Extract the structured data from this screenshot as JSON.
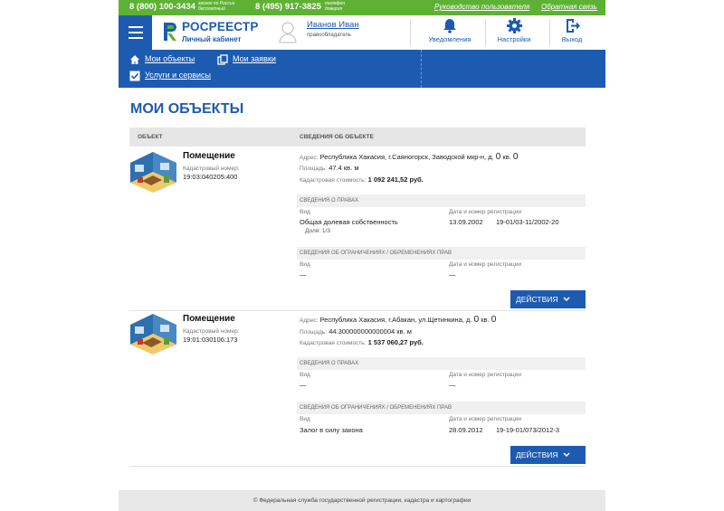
{
  "topbar": {
    "phone1": "8 (800) 100-3434",
    "phone1_note": "звонок по России бесплатный",
    "phone2": "8 (495) 917-3825",
    "phone2_note": "телефон доверия",
    "guide_link": "Руководство пользователя",
    "feedback_link": "Обратная связь"
  },
  "header": {
    "logo_title": "РОСРЕЕСТР",
    "logo_subtitle": "Личный кабинет",
    "user_name": "Иванов Иван",
    "user_role": "правообладатель",
    "notifications_label": "Уведомления",
    "settings_label": "Настройки",
    "logout_label": "Выход"
  },
  "nav": {
    "objects": "Мои объекты",
    "requests": "Мои заявки",
    "services": "Услуги и сервисы"
  },
  "page_title": "МОИ ОБЪЕКТЫ",
  "table": {
    "col_object": "ОБЪЕКТ",
    "col_info": "СВЕДЕНИЯ ОБ ОБЪЕКТЕ"
  },
  "labels": {
    "cadastral_number": "Кадастровый номер:",
    "address": "Адрес:",
    "area": "Площадь:",
    "cadastral_value": "Кадастровая стоимость:",
    "rights_section": "СВЕДЕНИЯ О ПРАВАХ",
    "restrictions_section": "СВЕДЕНИЯ ОБ ОГРАНИЧЕНИЯХ / ОБРЕМЕНЕНИЯХ ПРАВ",
    "kind": "Вид",
    "reg_date_number": "Дата и номер регистрации",
    "actions": "ДЕЙСТВИЯ"
  },
  "objects": [
    {
      "name": "Помещение",
      "cadastral": "19:03:040205:400",
      "address": "Республика Хакасия, г.Саяногорск, Заводской мкр-н, д.",
      "house": "0",
      "flat_prefix": "кв.",
      "flat": "0",
      "area": "47.4 кв. м",
      "value": "1 092 241,52 руб.",
      "rights_kind": "Общая долевая собственность",
      "rights_share": "Доля: 1/3",
      "rights_date": "13.09.2002",
      "rights_reg": "19-01/03-11/2002-20",
      "restr_kind": "—",
      "restr_date": "—"
    },
    {
      "name": "Помещение",
      "cadastral": "19:01:030106:173",
      "address": "Республика Хакасия, г.Абакан, ул.Щетинкина, д.",
      "house": "0",
      "flat_prefix": "кв.",
      "flat": "0",
      "area": "44.300000000000004 кв. м",
      "value": "1 537 060,27 руб.",
      "rights_kind": "—",
      "rights_date": "—",
      "restr_kind": "Залог в силу закона",
      "restr_date": "28.09.2012",
      "restr_reg": "19-19-01/073/2012-3"
    }
  ],
  "footer": "© Федеральная служба государственной регистрации, кадастра и картографии",
  "colors": {
    "brand_blue": "#1d5bb1",
    "topbar_green": "#5eb134"
  }
}
